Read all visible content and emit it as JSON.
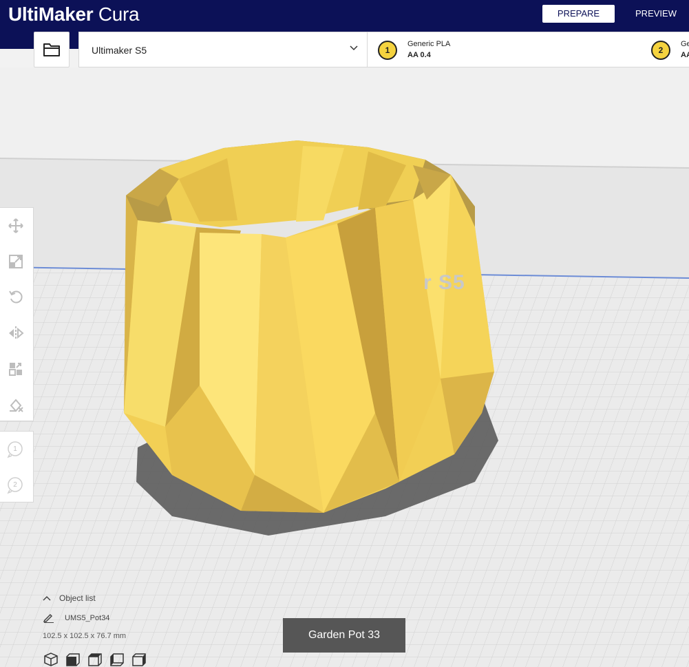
{
  "app": {
    "brand_bold": "UltiMaker",
    "brand_light": " Cura"
  },
  "stages": {
    "prepare": "PREPARE",
    "preview": "PREVIEW"
  },
  "printer": {
    "name": "Ultimaker S5"
  },
  "extruders": [
    {
      "index": "1",
      "material": "Generic PLA",
      "core": "AA 0.4"
    },
    {
      "index": "2",
      "material": "Ge",
      "core": "AA"
    }
  ],
  "viewport": {
    "build_plate_label": "r S5",
    "model_color": "#f5d33f"
  },
  "toolbar": {
    "tools": [
      "move-icon",
      "scale-icon",
      "rotate-icon",
      "mirror-icon",
      "per-model-settings-icon",
      "support-blocker-icon"
    ],
    "extruder_buttons": [
      "1",
      "2"
    ]
  },
  "object_list": {
    "toggle_label": "Object list",
    "object_name": "UMS5_Pot34",
    "dimensions": "102.5 x 102.5 x 76.7 mm"
  },
  "tooltip": {
    "text": "Garden Pot 33"
  },
  "colors": {
    "header": "#0c1157",
    "accent_yellow": "#f5d33f",
    "tooltip_bg": "#565656"
  }
}
